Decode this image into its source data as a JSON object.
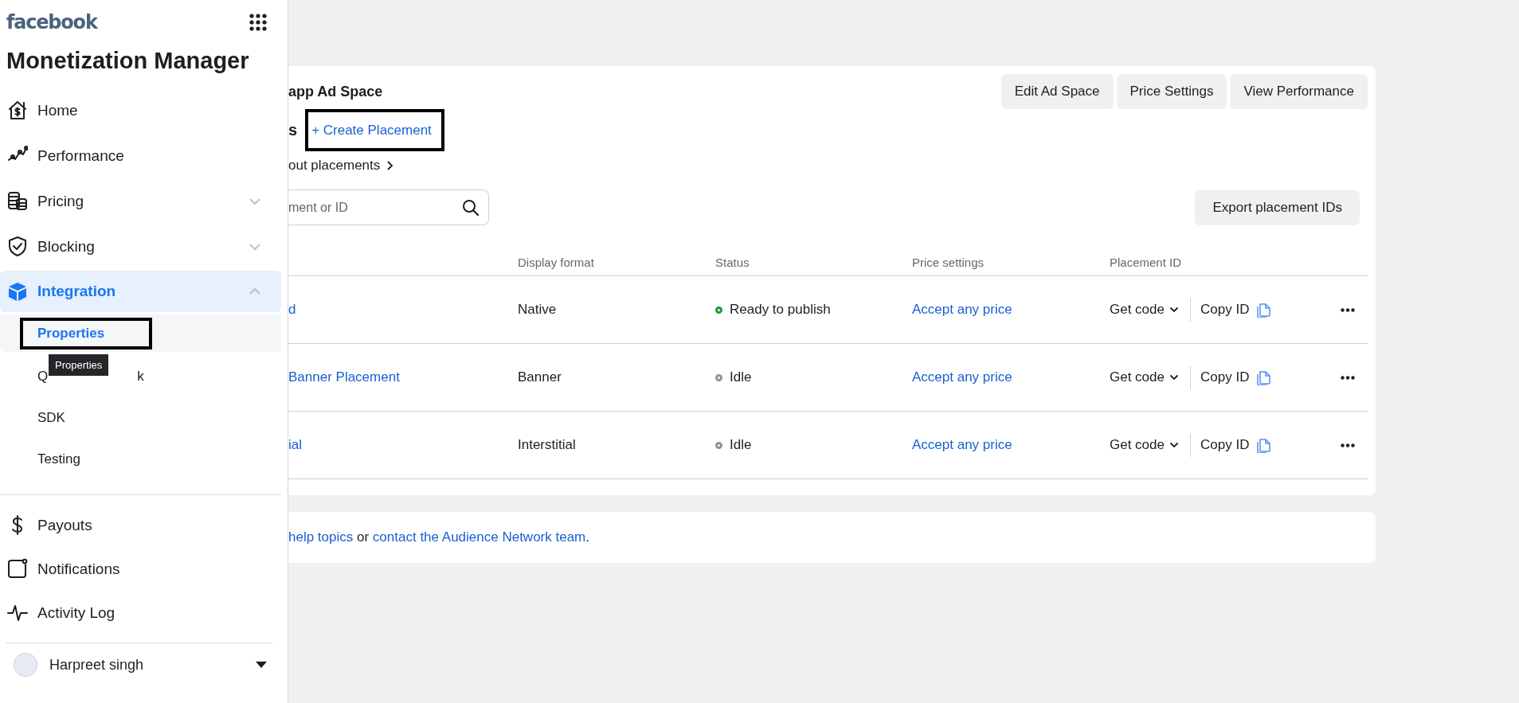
{
  "sidebar": {
    "logo": "facebook",
    "title": "Monetization Manager",
    "sections": [
      {
        "items": [
          {
            "label": "Home",
            "kind": "link",
            "selected": false
          },
          {
            "label": "Performance",
            "kind": "link",
            "selected": false
          },
          {
            "label": "Pricing",
            "kind": "group",
            "expanded": false,
            "selected": false
          },
          {
            "label": "Blocking",
            "kind": "group",
            "expanded": false,
            "selected": false
          },
          {
            "label": "Integration",
            "kind": "group",
            "expanded": true,
            "selected": true,
            "children": [
              {
                "label": "Properties",
                "selected": true,
                "framed": true,
                "tooltip": "Properties"
              },
              {
                "label": "Q",
                "label_end": "k",
                "selected": false,
                "framed": false
              },
              {
                "label": "SDK",
                "selected": false,
                "framed": false
              },
              {
                "label": "Testing",
                "selected": false,
                "framed": false
              }
            ]
          }
        ]
      },
      {
        "items": [
          {
            "label": "Payouts",
            "kind": "link",
            "selected": false
          },
          {
            "label": "Notifications",
            "kind": "link",
            "selected": false
          },
          {
            "label": "Activity Log",
            "kind": "link",
            "selected": false
          }
        ]
      }
    ],
    "user": {
      "name": "Harpreet singh"
    }
  },
  "card": {
    "title": "app Ad Space",
    "actions": [
      "Edit Ad Space",
      "Price Settings",
      "View Performance"
    ],
    "heading": "s",
    "create": {
      "label": "+ Create Placement",
      "framed": true
    },
    "learn": "out placements",
    "search": {
      "placeholder": "ment or ID"
    },
    "export": "Export placement IDs",
    "table": {
      "columns": [
        "Display format",
        "Status",
        "Price settings",
        "Placement ID"
      ],
      "rows": [
        {
          "name": "d",
          "format": "Native",
          "status": {
            "label": "Ready to publish",
            "color": "#1a9c3a"
          },
          "price": "Accept any price",
          "get_code": "Get code",
          "copy": "Copy ID"
        },
        {
          "name": "Banner Placement",
          "format": "Banner",
          "status": {
            "label": "Idle",
            "color": "#8d949e"
          },
          "price": "Accept any price",
          "get_code": "Get code",
          "copy": "Copy ID"
        },
        {
          "name": "ial",
          "format": "Interstitial",
          "status": {
            "label": "Idle",
            "color": "#8d949e"
          },
          "price": "Accept any price",
          "get_code": "Get code",
          "copy": "Copy ID"
        }
      ]
    }
  },
  "help": {
    "links": [
      "help topics",
      "contact the Audience Network team"
    ],
    "joiner": " or ",
    "end": "."
  }
}
